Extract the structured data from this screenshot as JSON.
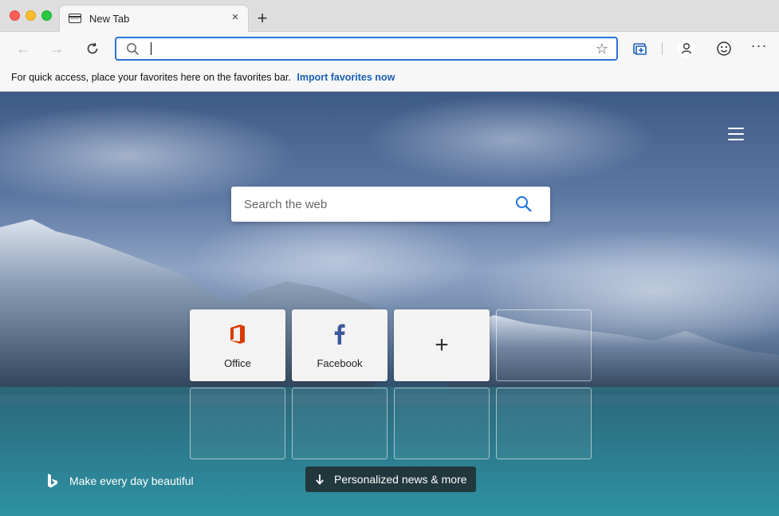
{
  "tab": {
    "title": "New Tab",
    "close_symbol": "×",
    "new_tab_symbol": "+"
  },
  "toolbar": {
    "back_symbol": "←",
    "forward_symbol": "→",
    "address_value": "",
    "more_symbol": "···"
  },
  "favorites_bar": {
    "message": "For quick access, place your favorites here on the favorites bar.",
    "import_link": "Import favorites now"
  },
  "ntp": {
    "search_placeholder": "Search the web",
    "tiles": [
      {
        "label": "Office",
        "icon": "office-icon"
      },
      {
        "label": "Facebook",
        "icon": "facebook-icon"
      },
      {
        "label": "",
        "icon": "plus-icon"
      }
    ],
    "tile_plus_symbol": "+",
    "footer_text": "Make every day beautiful",
    "news_button": "Personalized news & more"
  },
  "colors": {
    "accent": "#2e6fd8",
    "link": "#1a5fb4",
    "office": "#d83b01",
    "facebook": "#3b5998",
    "search_icon": "#1a73e8"
  }
}
